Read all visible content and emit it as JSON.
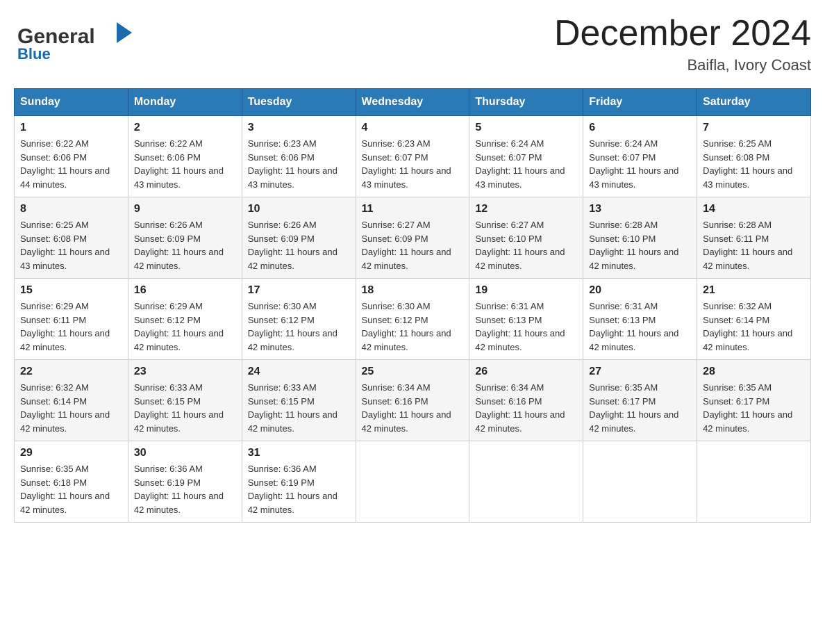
{
  "header": {
    "logo_general": "General",
    "logo_blue": "Blue",
    "title": "December 2024",
    "location": "Baifla, Ivory Coast"
  },
  "days_of_week": [
    "Sunday",
    "Monday",
    "Tuesday",
    "Wednesday",
    "Thursday",
    "Friday",
    "Saturday"
  ],
  "weeks": [
    [
      {
        "day": 1,
        "sunrise": "6:22 AM",
        "sunset": "6:06 PM",
        "daylight": "11 hours and 44 minutes."
      },
      {
        "day": 2,
        "sunrise": "6:22 AM",
        "sunset": "6:06 PM",
        "daylight": "11 hours and 43 minutes."
      },
      {
        "day": 3,
        "sunrise": "6:23 AM",
        "sunset": "6:06 PM",
        "daylight": "11 hours and 43 minutes."
      },
      {
        "day": 4,
        "sunrise": "6:23 AM",
        "sunset": "6:07 PM",
        "daylight": "11 hours and 43 minutes."
      },
      {
        "day": 5,
        "sunrise": "6:24 AM",
        "sunset": "6:07 PM",
        "daylight": "11 hours and 43 minutes."
      },
      {
        "day": 6,
        "sunrise": "6:24 AM",
        "sunset": "6:07 PM",
        "daylight": "11 hours and 43 minutes."
      },
      {
        "day": 7,
        "sunrise": "6:25 AM",
        "sunset": "6:08 PM",
        "daylight": "11 hours and 43 minutes."
      }
    ],
    [
      {
        "day": 8,
        "sunrise": "6:25 AM",
        "sunset": "6:08 PM",
        "daylight": "11 hours and 43 minutes."
      },
      {
        "day": 9,
        "sunrise": "6:26 AM",
        "sunset": "6:09 PM",
        "daylight": "11 hours and 42 minutes."
      },
      {
        "day": 10,
        "sunrise": "6:26 AM",
        "sunset": "6:09 PM",
        "daylight": "11 hours and 42 minutes."
      },
      {
        "day": 11,
        "sunrise": "6:27 AM",
        "sunset": "6:09 PM",
        "daylight": "11 hours and 42 minutes."
      },
      {
        "day": 12,
        "sunrise": "6:27 AM",
        "sunset": "6:10 PM",
        "daylight": "11 hours and 42 minutes."
      },
      {
        "day": 13,
        "sunrise": "6:28 AM",
        "sunset": "6:10 PM",
        "daylight": "11 hours and 42 minutes."
      },
      {
        "day": 14,
        "sunrise": "6:28 AM",
        "sunset": "6:11 PM",
        "daylight": "11 hours and 42 minutes."
      }
    ],
    [
      {
        "day": 15,
        "sunrise": "6:29 AM",
        "sunset": "6:11 PM",
        "daylight": "11 hours and 42 minutes."
      },
      {
        "day": 16,
        "sunrise": "6:29 AM",
        "sunset": "6:12 PM",
        "daylight": "11 hours and 42 minutes."
      },
      {
        "day": 17,
        "sunrise": "6:30 AM",
        "sunset": "6:12 PM",
        "daylight": "11 hours and 42 minutes."
      },
      {
        "day": 18,
        "sunrise": "6:30 AM",
        "sunset": "6:12 PM",
        "daylight": "11 hours and 42 minutes."
      },
      {
        "day": 19,
        "sunrise": "6:31 AM",
        "sunset": "6:13 PM",
        "daylight": "11 hours and 42 minutes."
      },
      {
        "day": 20,
        "sunrise": "6:31 AM",
        "sunset": "6:13 PM",
        "daylight": "11 hours and 42 minutes."
      },
      {
        "day": 21,
        "sunrise": "6:32 AM",
        "sunset": "6:14 PM",
        "daylight": "11 hours and 42 minutes."
      }
    ],
    [
      {
        "day": 22,
        "sunrise": "6:32 AM",
        "sunset": "6:14 PM",
        "daylight": "11 hours and 42 minutes."
      },
      {
        "day": 23,
        "sunrise": "6:33 AM",
        "sunset": "6:15 PM",
        "daylight": "11 hours and 42 minutes."
      },
      {
        "day": 24,
        "sunrise": "6:33 AM",
        "sunset": "6:15 PM",
        "daylight": "11 hours and 42 minutes."
      },
      {
        "day": 25,
        "sunrise": "6:34 AM",
        "sunset": "6:16 PM",
        "daylight": "11 hours and 42 minutes."
      },
      {
        "day": 26,
        "sunrise": "6:34 AM",
        "sunset": "6:16 PM",
        "daylight": "11 hours and 42 minutes."
      },
      {
        "day": 27,
        "sunrise": "6:35 AM",
        "sunset": "6:17 PM",
        "daylight": "11 hours and 42 minutes."
      },
      {
        "day": 28,
        "sunrise": "6:35 AM",
        "sunset": "6:17 PM",
        "daylight": "11 hours and 42 minutes."
      }
    ],
    [
      {
        "day": 29,
        "sunrise": "6:35 AM",
        "sunset": "6:18 PM",
        "daylight": "11 hours and 42 minutes."
      },
      {
        "day": 30,
        "sunrise": "6:36 AM",
        "sunset": "6:19 PM",
        "daylight": "11 hours and 42 minutes."
      },
      {
        "day": 31,
        "sunrise": "6:36 AM",
        "sunset": "6:19 PM",
        "daylight": "11 hours and 42 minutes."
      },
      null,
      null,
      null,
      null
    ]
  ]
}
